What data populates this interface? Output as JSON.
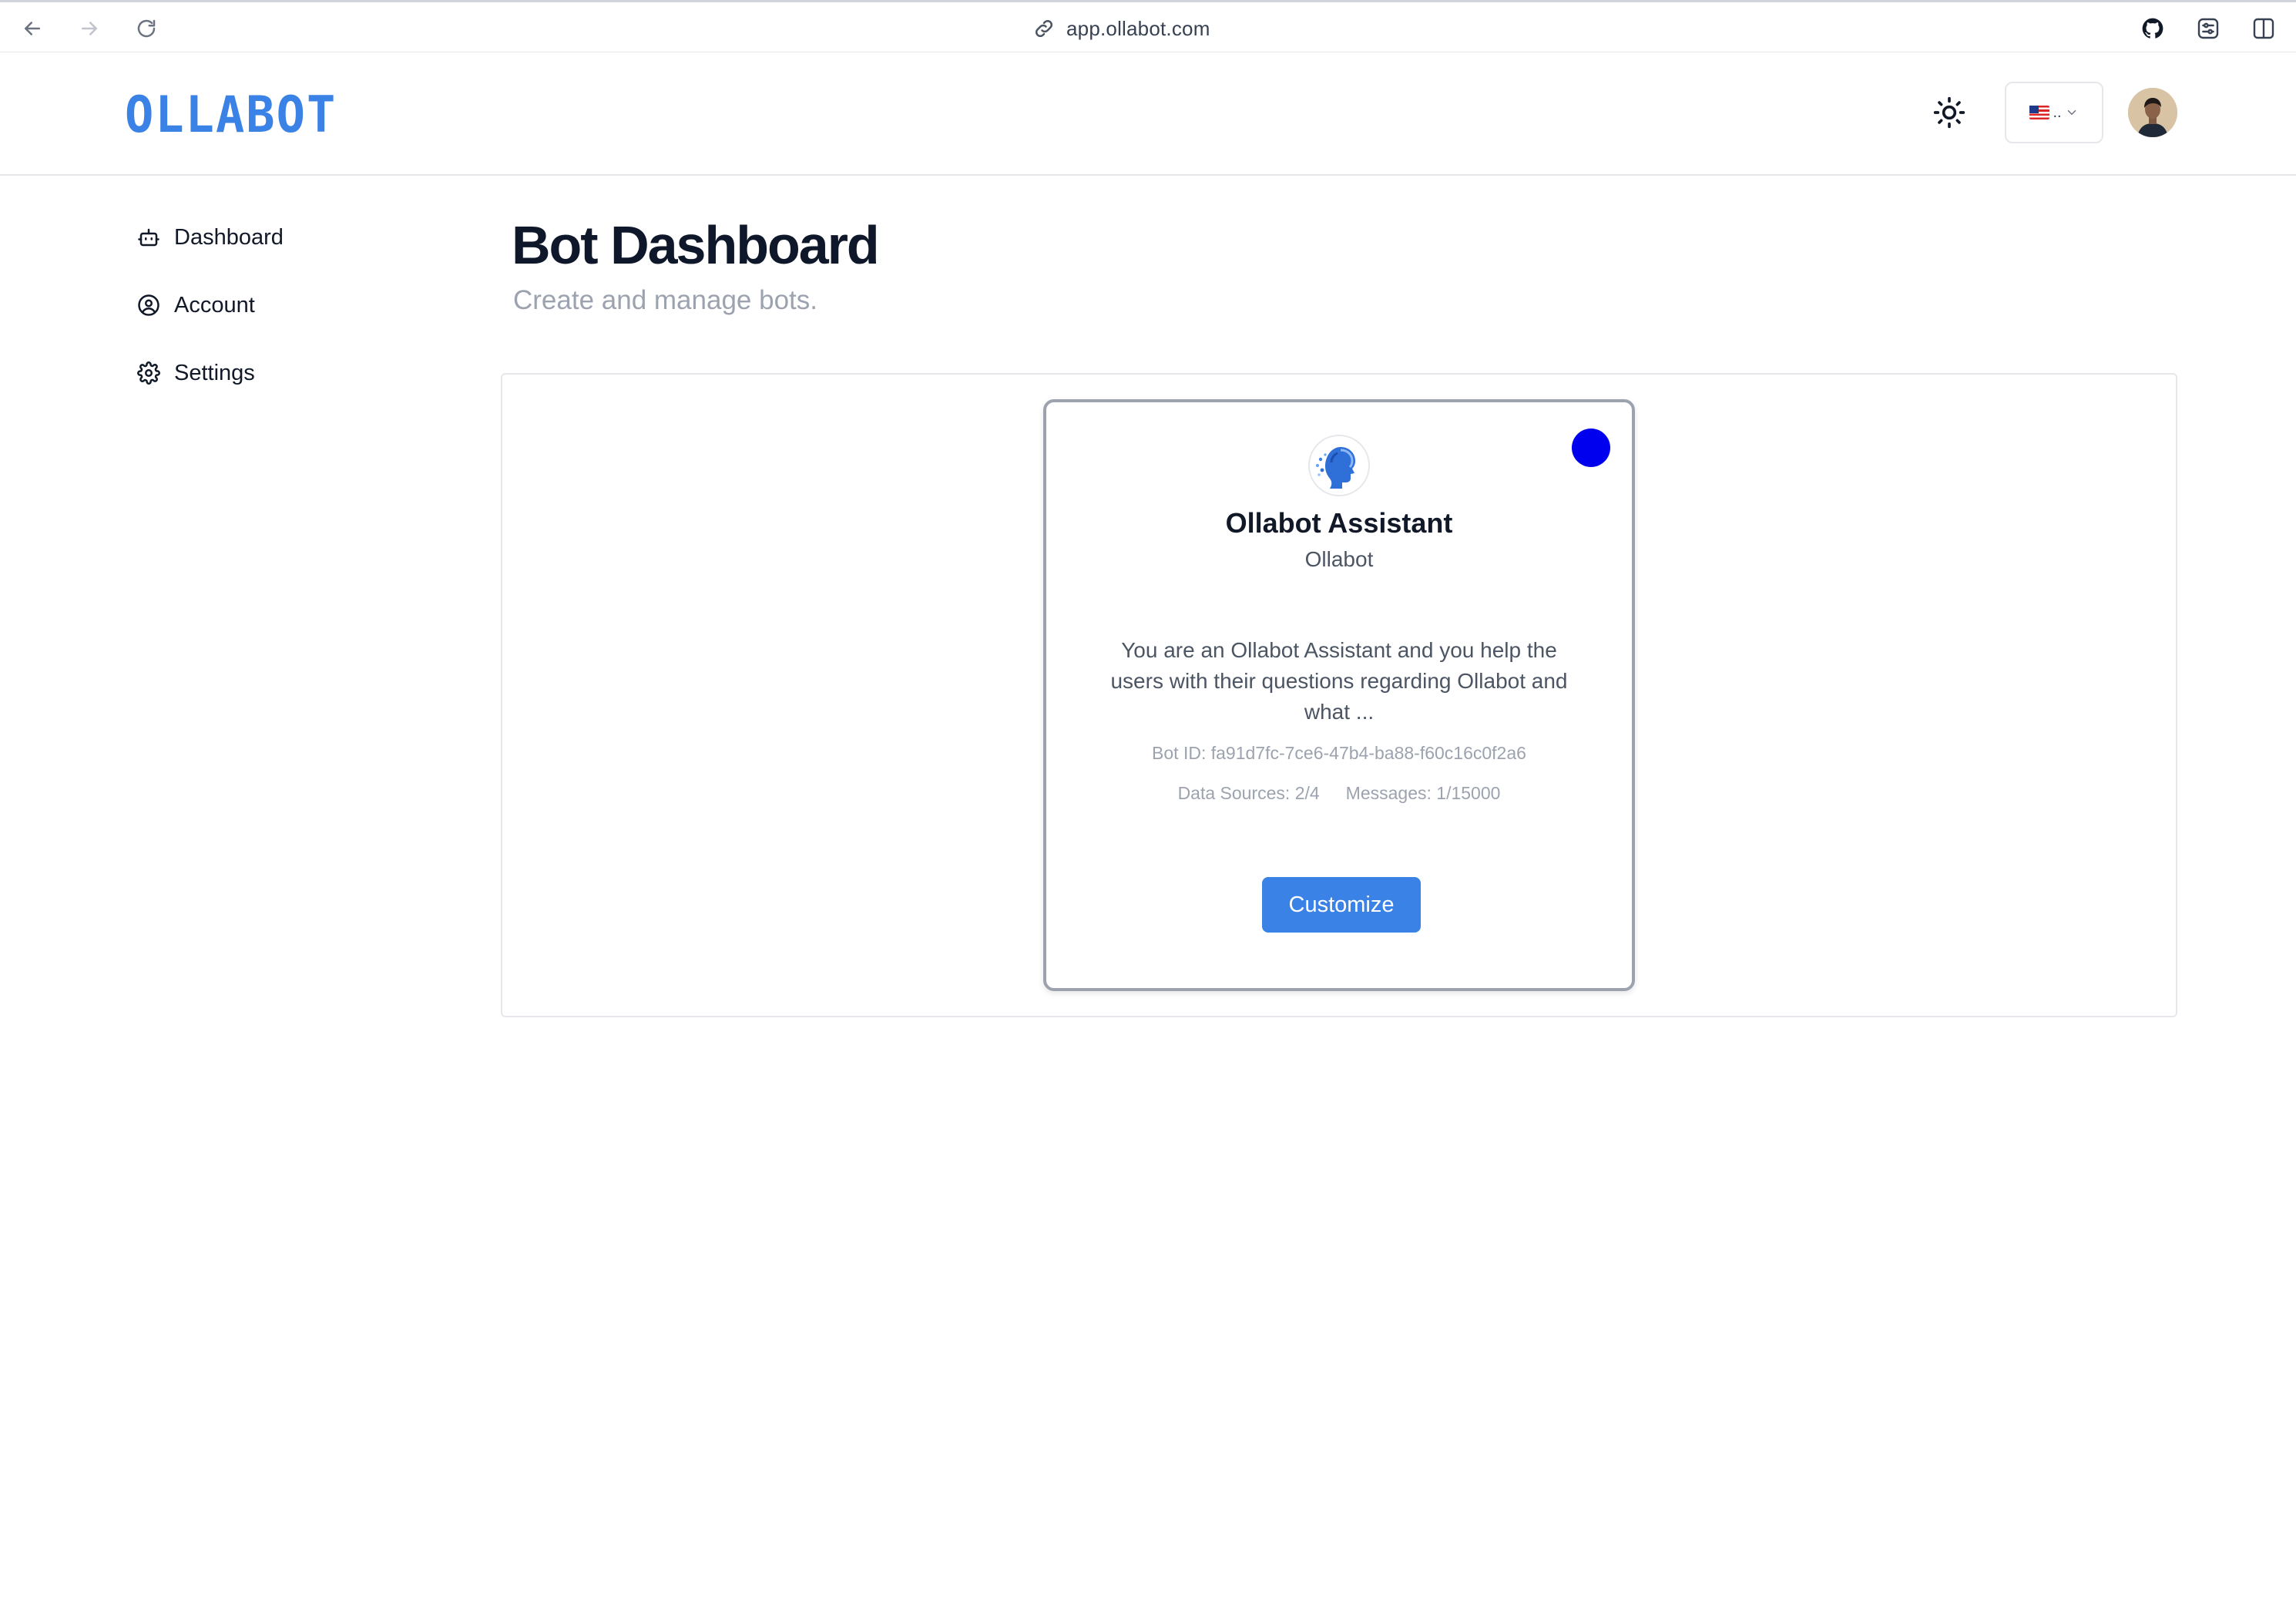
{
  "browser": {
    "url": "app.ollabot.com"
  },
  "header": {
    "logo_text": "OLLABOT",
    "language_label": "..",
    "brand_color": "#3b82e6"
  },
  "sidebar": {
    "items": [
      {
        "label": "Dashboard",
        "icon": "bot-icon"
      },
      {
        "label": "Account",
        "icon": "user-circle-icon"
      },
      {
        "label": "Settings",
        "icon": "gear-icon"
      }
    ]
  },
  "main": {
    "title": "Bot Dashboard",
    "subtitle": "Create and manage bots."
  },
  "bot": {
    "name": "Ollabot Assistant",
    "organization": "Ollabot",
    "description": "You are an Ollabot Assistant and you help the users with their questions regarding Ollabot and what ...",
    "id_text": "Bot ID: fa91d7fc-7ce6-47b4-ba88-f60c16c0f2a6",
    "data_sources": "Data Sources: 2/4",
    "messages": "Messages: 1/15000",
    "status_color": "#0000ee",
    "customize_label": "Customize"
  }
}
